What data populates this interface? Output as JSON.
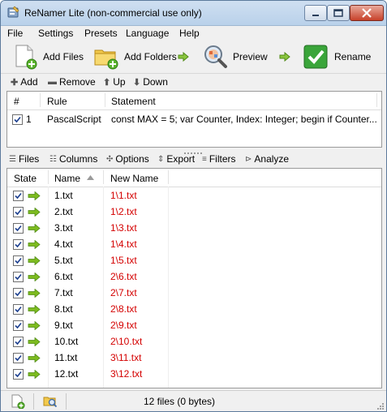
{
  "window": {
    "title": "ReNamer Lite (non-commercial use only)"
  },
  "menu": [
    "File",
    "Settings",
    "Presets",
    "Language",
    "Help"
  ],
  "toolbar": {
    "add_files": "Add Files",
    "add_folders": "Add Folders",
    "preview": "Preview",
    "rename": "Rename"
  },
  "rules_toolbar": {
    "add": "Add",
    "remove": "Remove",
    "up": "Up",
    "down": "Down"
  },
  "rules_table": {
    "headers": {
      "num": "#",
      "rule": "Rule",
      "statement": "Statement"
    },
    "rows": [
      {
        "num": "1",
        "rule": "PascalScript",
        "statement": "const MAX = 5; var Counter, Index: Integer; begin if Counter...",
        "checked": true
      }
    ]
  },
  "files_tabs": [
    "Files",
    "Columns",
    "Options",
    "Export",
    "Filters",
    "Analyze"
  ],
  "files_table": {
    "headers": {
      "state": "State",
      "name": "Name",
      "new_name": "New Name"
    },
    "rows": [
      {
        "name": "1.txt",
        "new_name": "1\\1.txt"
      },
      {
        "name": "2.txt",
        "new_name": "1\\2.txt"
      },
      {
        "name": "3.txt",
        "new_name": "1\\3.txt"
      },
      {
        "name": "4.txt",
        "new_name": "1\\4.txt"
      },
      {
        "name": "5.txt",
        "new_name": "1\\5.txt"
      },
      {
        "name": "6.txt",
        "new_name": "2\\6.txt"
      },
      {
        "name": "7.txt",
        "new_name": "2\\7.txt"
      },
      {
        "name": "8.txt",
        "new_name": "2\\8.txt"
      },
      {
        "name": "9.txt",
        "new_name": "2\\9.txt"
      },
      {
        "name": "10.txt",
        "new_name": "2\\10.txt"
      },
      {
        "name": "11.txt",
        "new_name": "3\\11.txt"
      },
      {
        "name": "12.txt",
        "new_name": "3\\12.txt"
      }
    ]
  },
  "status": {
    "text": "12 files (0 bytes)"
  },
  "colors": {
    "new_name": "#d40000",
    "arrow": "#7dbb1f",
    "rename_check": "#3aa53a"
  }
}
